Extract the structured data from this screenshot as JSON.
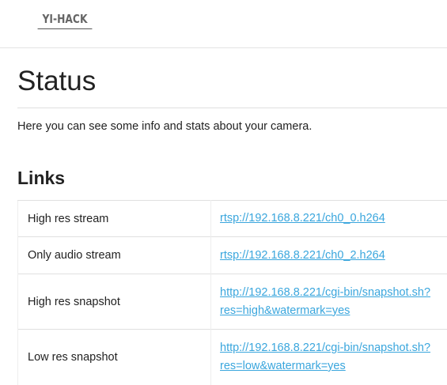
{
  "header": {
    "logo_text": "YI-HACK"
  },
  "page": {
    "title": "Status",
    "intro": "Here you can see some info and stats about your camera."
  },
  "links": {
    "title": "Links",
    "rows": [
      {
        "label": "High res stream",
        "value": "rtsp://192.168.8.221/ch0_0.h264"
      },
      {
        "label": "Only audio stream",
        "value": "rtsp://192.168.8.221/ch0_2.h264"
      },
      {
        "label": "High res snapshot",
        "value": "http://192.168.8.221/cgi-bin/snapshot.sh?res=high&watermark=yes",
        "line1": "http://192.168.8.221/cgi-bin/snapshot.sh?",
        "line2": "res=high&watermark=yes"
      },
      {
        "label": "Low res snapshot",
        "value": "http://192.168.8.221/cgi-bin/snapshot.sh?res=low&watermark=yes",
        "line1": "http://192.168.8.221/cgi-bin/snapshot.sh?",
        "line2": "res=low&watermark=yes"
      }
    ]
  },
  "colors": {
    "link": "#3aa6dd",
    "text": "#222222",
    "divider": "#e0e0e0"
  }
}
